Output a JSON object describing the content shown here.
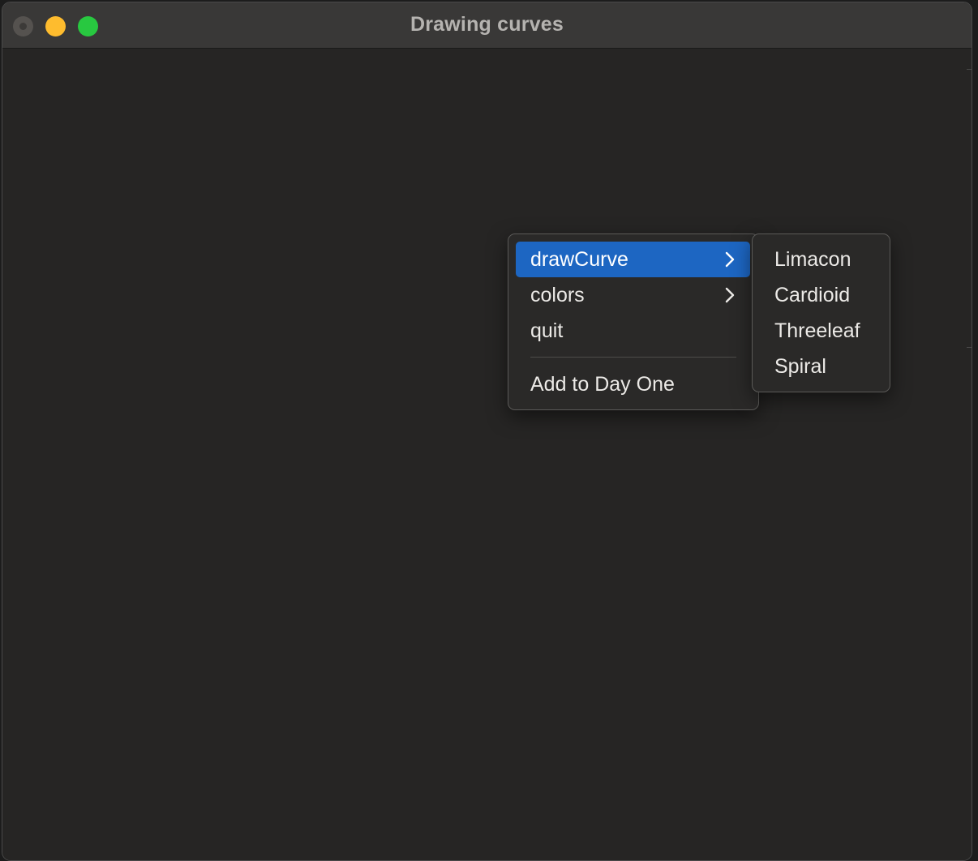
{
  "window": {
    "title": "Drawing curves"
  },
  "context_menu": {
    "items": [
      {
        "label": "drawCurve",
        "has_submenu": true,
        "highlighted": true
      },
      {
        "label": "colors",
        "has_submenu": true,
        "highlighted": false
      },
      {
        "label": "quit",
        "has_submenu": false,
        "highlighted": false
      },
      {
        "label": "Add to Day One",
        "has_submenu": false,
        "highlighted": false
      }
    ]
  },
  "submenu": {
    "items": [
      {
        "label": "Limacon"
      },
      {
        "label": "Cardioid"
      },
      {
        "label": "Threeleaf"
      },
      {
        "label": "Spiral"
      }
    ]
  },
  "colors": {
    "highlight": "#1d66c2",
    "close_button": "#55524f",
    "minimize_button": "#febc2e",
    "zoom_button": "#28c840"
  }
}
